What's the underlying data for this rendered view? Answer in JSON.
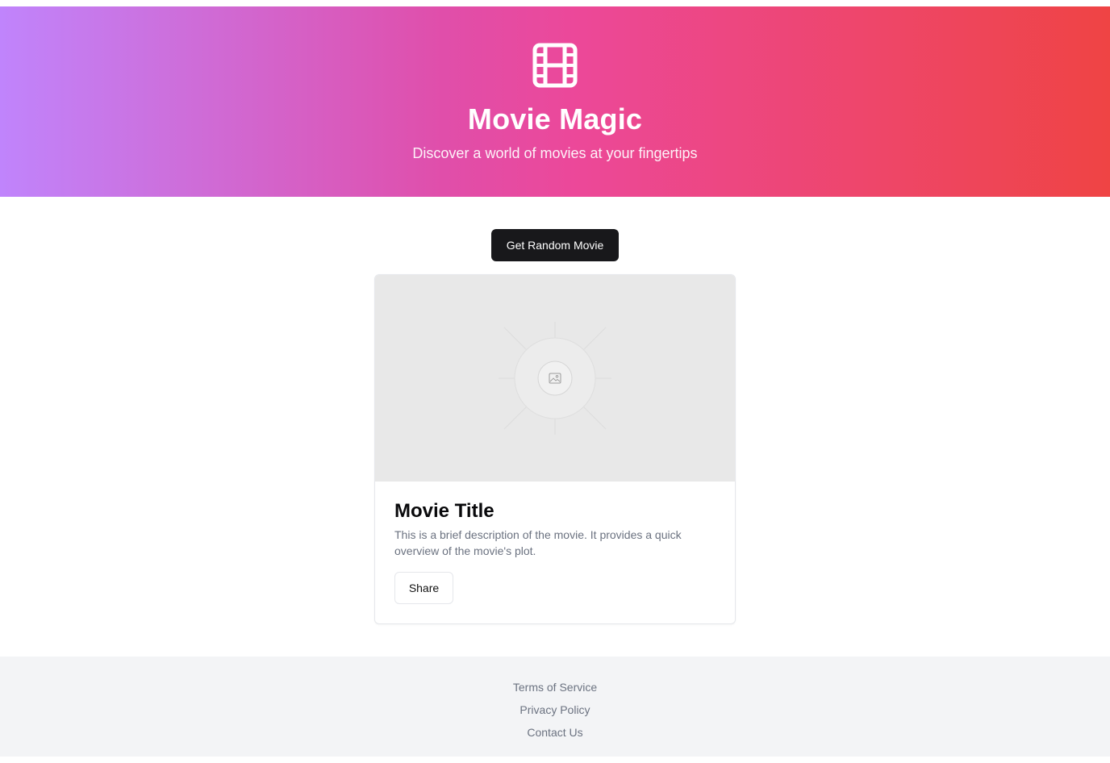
{
  "hero": {
    "icon": "film-icon",
    "title": "Movie Magic",
    "subtitle": "Discover a world of movies at your fingertips"
  },
  "actions": {
    "random_label": "Get Random Movie"
  },
  "card": {
    "image_icon": "image-placeholder-icon",
    "title": "Movie Title",
    "description": "This is a brief description of the movie. It provides a quick overview of the movie's plot.",
    "share_label": "Share"
  },
  "footer": {
    "links": [
      "Terms of Service",
      "Privacy Policy",
      "Contact Us"
    ]
  },
  "colors": {
    "gradient_start": "#c084fc",
    "gradient_mid": "#ec4899",
    "gradient_end": "#ef4444",
    "primary_button": "#18181b"
  }
}
